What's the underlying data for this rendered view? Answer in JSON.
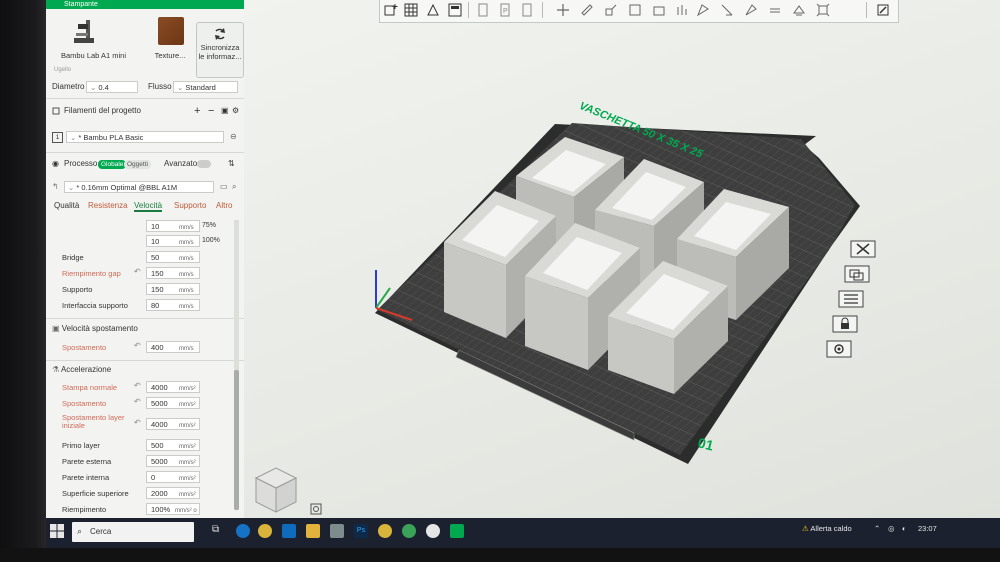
{
  "panel": {
    "header": "Stampante",
    "printer": {
      "name": "Bambu Lab A1 mini",
      "plate": "Texture...",
      "sync_label": "Sincronizza le informaz..."
    },
    "nozzle_section": "Ugello",
    "diameter": {
      "label": "Diametro",
      "value": "0.4"
    },
    "flow": {
      "label": "Flusso",
      "value": "Standard"
    },
    "filaments": {
      "title": "Filamenti del progetto",
      "slot": "1",
      "name": "* Bambu PLA Basic"
    },
    "process": {
      "title": "Processo",
      "global_label": "Globale",
      "objects_label": "Oggetti",
      "advanced_label": "Avanzato",
      "profile": "* 0.16mm Optimal @BBL A1M"
    },
    "tabs": [
      "Qualità",
      "Resistenza",
      "Velocità",
      "Supporto",
      "Altro"
    ],
    "top_rows": [
      {
        "value": "10",
        "unit": "mm/s",
        "extra": "75%"
      },
      {
        "value": "10",
        "unit": "mm/s",
        "extra": "100%"
      }
    ],
    "speed_rows": [
      {
        "label": "Bridge",
        "value": "50",
        "unit": "mm/s",
        "modified": false
      },
      {
        "label": "Riempimento gap",
        "value": "150",
        "unit": "mm/s",
        "modified": true
      },
      {
        "label": "Supporto",
        "value": "150",
        "unit": "mm/s",
        "modified": false
      },
      {
        "label": "Interfaccia supporto",
        "value": "80",
        "unit": "mm/s",
        "modified": false
      }
    ],
    "travel": {
      "title": "Velocità spostamento",
      "label": "Spostamento",
      "value": "400",
      "unit": "mm/s"
    },
    "accel": {
      "title": "Accelerazione",
      "rows": [
        {
          "label": "Stampa normale",
          "value": "4000",
          "unit": "mm/s²",
          "modified": true
        },
        {
          "label": "Spostamento",
          "value": "5000",
          "unit": "mm/s²",
          "modified": true
        },
        {
          "label": "Spostamento layer iniziale",
          "value": "4000",
          "unit": "mm/s²",
          "modified": true
        },
        {
          "label": "Primo layer",
          "value": "500",
          "unit": "mm/s²",
          "modified": false
        },
        {
          "label": "Parete esterna",
          "value": "5000",
          "unit": "mm/s²",
          "modified": false
        },
        {
          "label": "Parete interna",
          "value": "0",
          "unit": "mm/s²",
          "modified": false
        },
        {
          "label": "Superficie superiore",
          "value": "2000",
          "unit": "mm/s²",
          "modified": false
        },
        {
          "label": "Riempimento",
          "value": "100%",
          "unit": "mm/s² o %",
          "modified": false
        }
      ]
    }
  },
  "viewport": {
    "plate_title": "VASCHETTA 50 X 35 X 25",
    "plate_number": "01",
    "accent": "#00a94f"
  },
  "taskbar": {
    "search_placeholder": "Cerca",
    "weather": "Allerta caldo",
    "time": "23:07"
  }
}
